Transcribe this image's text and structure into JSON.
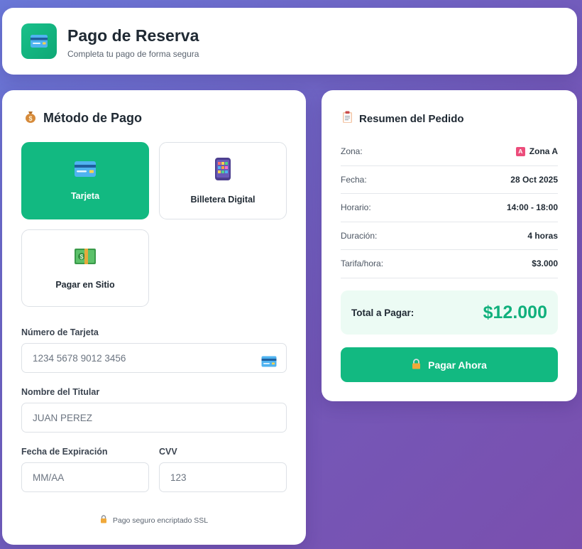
{
  "header": {
    "title": "Pago de Reserva",
    "subtitle": "Completa tu pago de forma segura",
    "icon": "credit-card-icon"
  },
  "payment": {
    "section_title": "Método de Pago",
    "section_icon": "money-bag-icon",
    "methods": [
      {
        "label": "Tarjeta",
        "icon": "credit-card-icon",
        "selected": true
      },
      {
        "label": "Billetera Digital",
        "icon": "mobile-wallet-icon",
        "selected": false
      },
      {
        "label": "Pagar en Sitio",
        "icon": "cash-icon",
        "selected": false
      }
    ],
    "card_number": {
      "label": "Número de Tarjeta",
      "placeholder": "1234 5678 9012 3456",
      "value": ""
    },
    "holder_name": {
      "label": "Nombre del Titular",
      "placeholder": "JUAN PEREZ",
      "value": ""
    },
    "expiry": {
      "label": "Fecha de Expiración",
      "placeholder": "MM/AA",
      "value": ""
    },
    "cvv": {
      "label": "CVV",
      "placeholder": "123",
      "value": ""
    },
    "secure_note": "Pago seguro encriptado SSL"
  },
  "summary": {
    "title": "Resumen del Pedido",
    "title_icon": "clipboard-icon",
    "rows": [
      {
        "label": "Zona:",
        "value": "Zona A",
        "badge": "A"
      },
      {
        "label": "Fecha:",
        "value": "28 Oct 2025"
      },
      {
        "label": "Horario:",
        "value": "14:00 - 18:00"
      },
      {
        "label": "Duración:",
        "value": "4 horas"
      },
      {
        "label": "Tarifa/hora:",
        "value": "$3.000"
      }
    ],
    "total_label": "Total a Pagar:",
    "total_value": "$12.000",
    "pay_button": "Pagar Ahora"
  },
  "colors": {
    "accent": "#12b981",
    "total_text": "#10b07c",
    "total_bg": "#ecfbf4",
    "zone_badge": "#ec4d7b",
    "background_start": "#6a78d8",
    "background_end": "#7a4fae"
  }
}
